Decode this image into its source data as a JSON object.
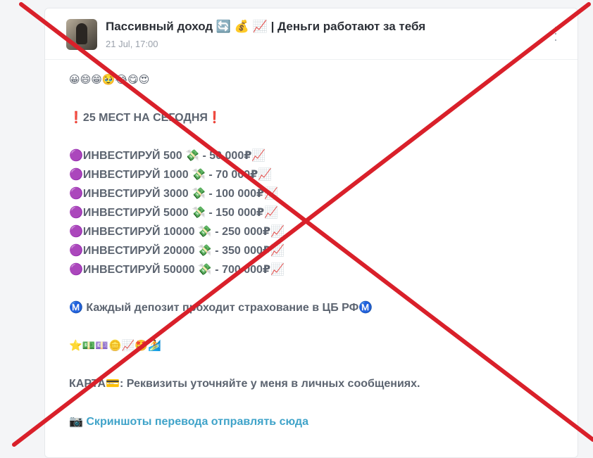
{
  "post": {
    "channel_title": "Пассивный доход 🔄 💰 📈 | Деньги работают за тебя",
    "timestamp": "21 Jul, 17:00",
    "lines": {
      "emoji_row_1": "😀😄😁🥹😂😋😍",
      "places_today": "❗25 МЕСТ НА СЕГОДНЯ❗",
      "invest_1": "🟣ИНВЕСТИРУЙ 500 💸 - 50 000₽📈",
      "invest_2": "🟣ИНВЕСТИРУЙ 1000 💸 - 70 000₽📈",
      "invest_3": "🟣ИНВЕСТИРУЙ 3000 💸 - 100 000₽📈",
      "invest_4": "🟣ИНВЕСТИРУЙ 5000 💸 - 150 000₽📈",
      "invest_5": "🟣ИНВЕСТИРУЙ 10000 💸 - 250 000₽📈",
      "invest_6": "🟣ИНВЕСТИРУЙ 20000 💸 - 350 000₽📈",
      "invest_7": "🟣ИНВЕСТИРУЙ 50000 💸 - 700 000₽📈",
      "insurance": "Ⓜ️ Каждый депозит проходит страхование в ЦБ РФⓂ️",
      "emoji_row_2": "⭐💵💷🪙📈🤩🏄",
      "card_details": "КАРТА💳: Реквизиты уточняйте у меня в личных сообщениях.",
      "screenshot_icon": "📷",
      "screenshot_link": "Скриншоты перевода отправлять сюда"
    }
  },
  "colors": {
    "cross": "#d9202a",
    "link": "#3fa3c9",
    "text": "#5c6470"
  }
}
